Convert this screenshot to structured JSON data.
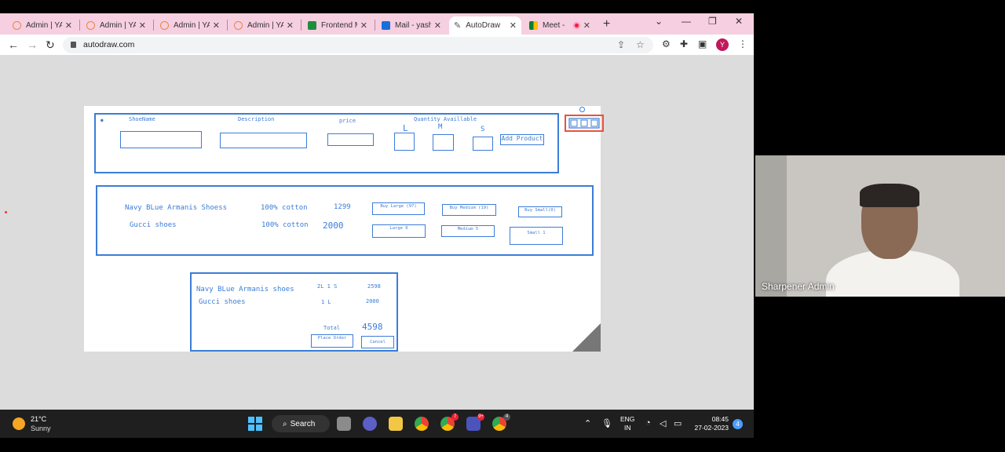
{
  "browser": {
    "tabs": [
      {
        "label": "Admin | YA",
        "favicon": "admin-icon"
      },
      {
        "label": "Admin | YA",
        "favicon": "admin-icon"
      },
      {
        "label": "Admin | YA",
        "favicon": "admin-icon"
      },
      {
        "label": "Admin | YA",
        "favicon": "admin-icon"
      },
      {
        "label": "Frontend M",
        "favicon": "sheets-icon"
      },
      {
        "label": "Mail - yash",
        "favicon": "outlook-icon"
      },
      {
        "label": "AutoDraw",
        "favicon": "autodraw-icon",
        "active": true
      },
      {
        "label": "Meet -",
        "favicon": "meet-icon"
      }
    ],
    "url": "autodraw.com",
    "profile_initial": "Y",
    "accent_color": "#f6cfe0"
  },
  "drawing": {
    "headers": {
      "shoe_name": "ShoeName",
      "description": "Description",
      "price": "price",
      "quantity": "Quantity Availlable",
      "size_l": "L",
      "size_m": "M",
      "size_s": "S"
    },
    "add_product": "Add Product",
    "rows": [
      {
        "name": "Navy BLue Armanis Shoess",
        "desc": "100% cotton",
        "price": "1299",
        "buy_large": "Buy Large (97)",
        "buy_medium": "Buy Medium (19)",
        "buy_small": "Buy Small(0)"
      },
      {
        "name": "Gucci  shoes",
        "desc": "100% cotton",
        "price": "2000",
        "buy_large": "Large  0",
        "buy_medium": "Medium 5",
        "buy_small": "Small 1"
      }
    ],
    "cart": {
      "items": [
        {
          "name": "Navy BLue Armanis shoes",
          "qty": "2L 1 S",
          "amount": "2598"
        },
        {
          "name": "Gucci shoes",
          "qty": "1 L",
          "amount": "2000"
        }
      ],
      "total_label": "Total",
      "total_value": "4598",
      "place_order": "Place Order",
      "cancel": "Cancel"
    }
  },
  "video": {
    "participant": "Sharpener Admin"
  },
  "taskbar": {
    "temperature": "21°C",
    "condition": "Sunny",
    "search_label": "Search",
    "lang_line1": "ENG",
    "lang_line2": "IN",
    "time": "08:45",
    "date": "27-02-2023",
    "notification_count": "4",
    "chrome_badge_1": "7",
    "teams_badge": "9+",
    "chrome_badge_2": "4"
  }
}
